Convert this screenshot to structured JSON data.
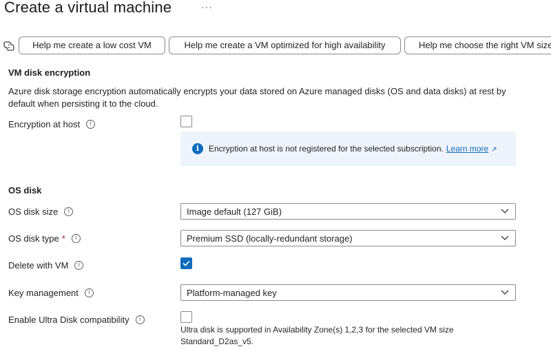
{
  "header": {
    "title": "Create a virtual machine",
    "more_label": "···"
  },
  "assist": {
    "icon": "copilot-icon",
    "buttons": [
      "Help me create a low cost VM",
      "Help me create a VM optimized for high availability",
      "Help me choose the right VM size"
    ]
  },
  "encryption": {
    "section_title": "VM disk encryption",
    "description": "Azure disk storage encryption automatically encrypts your data stored on Azure managed disks (OS and data disks) at rest by default when persisting it to the cloud.",
    "host_label": "Encryption at host",
    "host_checked": false,
    "info_message": "Encryption at host is not registered for the selected subscription.",
    "learn_more": "Learn more"
  },
  "os_disk": {
    "section_title": "OS disk",
    "size_label": "OS disk size",
    "size_value": "Image default (127 GiB)",
    "type_label": "OS disk type",
    "required_mark": "*",
    "type_value": "Premium SSD (locally-redundant storage)",
    "delete_label": "Delete with VM",
    "delete_checked": true,
    "key_label": "Key management",
    "key_value": "Platform-managed key",
    "ultra_label": "Enable Ultra Disk compatibility",
    "ultra_checked": false,
    "ultra_note": "Ultra disk is supported in Availability Zone(s) 1,2,3 for the selected VM size Standard_D2as_v5."
  },
  "colors": {
    "accent": "#0f6cbd",
    "info_background": "#eef4fb",
    "required": "#a4262c"
  }
}
